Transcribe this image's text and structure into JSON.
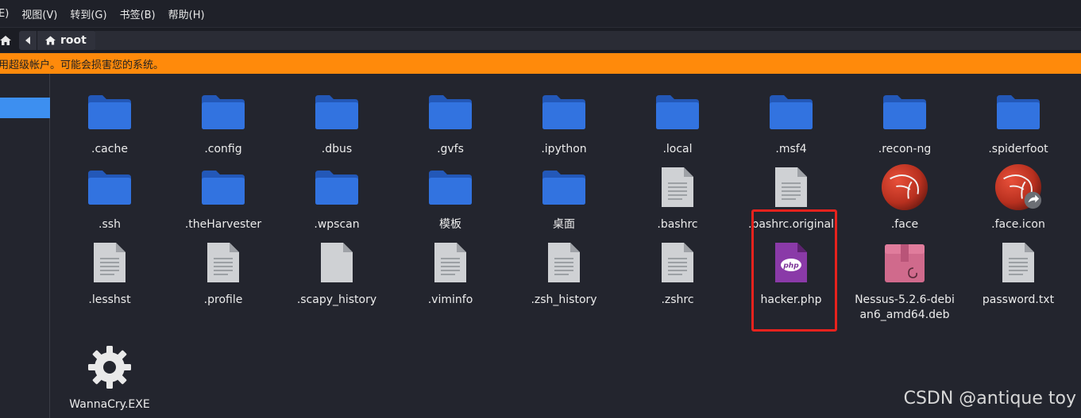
{
  "menubar": {
    "items": [
      "E)",
      "视图(V)",
      "转到(G)",
      "书签(B)",
      "帮助(H)"
    ]
  },
  "location": {
    "breadcrumb": "root"
  },
  "warning": {
    "text": "用超级帐户。可能会损害您的系统。",
    "color": "#ff8a0b"
  },
  "files": [
    {
      "name": ".cache",
      "icon": "folder-icon"
    },
    {
      "name": ".config",
      "icon": "folder-icon"
    },
    {
      "name": ".dbus",
      "icon": "folder-icon"
    },
    {
      "name": ".gvfs",
      "icon": "folder-icon"
    },
    {
      "name": ".ipython",
      "icon": "folder-icon"
    },
    {
      "name": ".local",
      "icon": "folder-icon"
    },
    {
      "name": ".msf4",
      "icon": "folder-icon"
    },
    {
      "name": ".recon-ng",
      "icon": "folder-icon"
    },
    {
      "name": ".spiderfoot",
      "icon": "folder-icon"
    },
    {
      "name": ".ssh",
      "icon": "folder-icon"
    },
    {
      "name": ".theHarvester",
      "icon": "folder-icon"
    },
    {
      "name": ".wpscan",
      "icon": "folder-icon"
    },
    {
      "name": "模板",
      "icon": "folder-icon"
    },
    {
      "name": "桌面",
      "icon": "folder-icon"
    },
    {
      "name": ".bashrc",
      "icon": "text-file-icon"
    },
    {
      "name": ".bashrc.original",
      "icon": "text-file-icon"
    },
    {
      "name": ".face",
      "icon": "kali-logo-icon"
    },
    {
      "name": ".face.icon",
      "icon": "kali-logo-link-icon"
    },
    {
      "name": ".lesshst",
      "icon": "text-file-icon"
    },
    {
      "name": ".profile",
      "icon": "text-file-icon"
    },
    {
      "name": ".scapy_history",
      "icon": "blank-file-icon"
    },
    {
      "name": ".viminfo",
      "icon": "text-file-icon"
    },
    {
      "name": ".zsh_history",
      "icon": "text-file-icon"
    },
    {
      "name": ".zshrc",
      "icon": "text-file-icon"
    },
    {
      "name": "hacker.php",
      "icon": "php-file-icon"
    },
    {
      "name": "Nessus-5.2.6-debian6_amd64.deb",
      "icon": "deb-package-icon"
    },
    {
      "name": "password.txt",
      "icon": "text-file-icon"
    },
    {
      "name": "WannaCry.EXE",
      "icon": "gear-icon"
    }
  ],
  "watermark": "CSDN @antique toy",
  "colors": {
    "folder": "#2f6fd6",
    "selection": "#3d8ff0",
    "highlight_box": "#e8221d"
  }
}
